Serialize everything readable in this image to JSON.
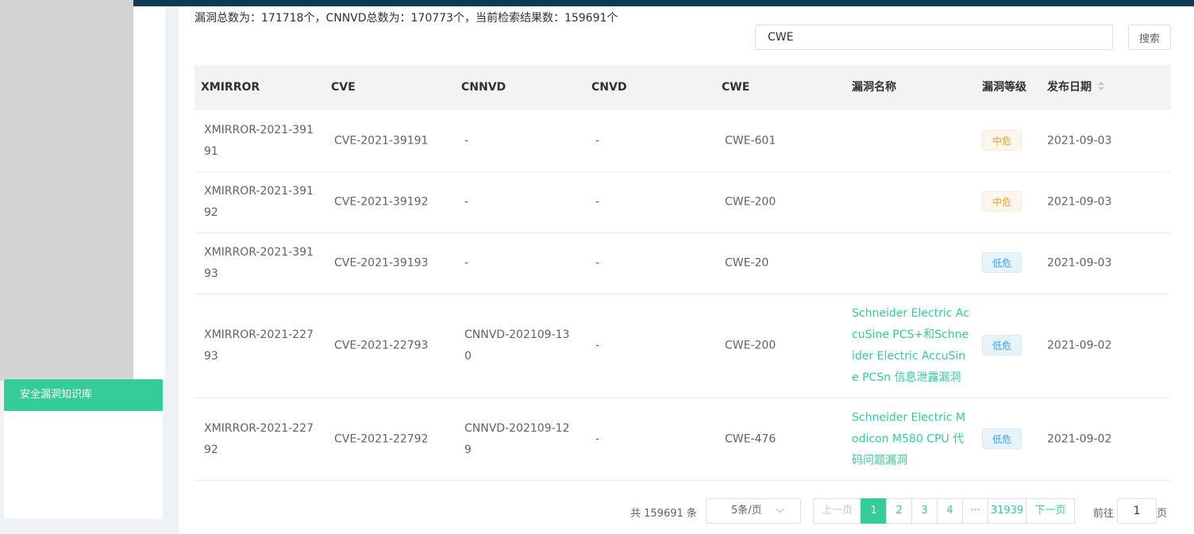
{
  "sidebar": {
    "active_item": "安全漏洞知识库"
  },
  "summary": "漏洞总数为：171718个，CNNVD总数为：170773个，当前检索结果数：159691个",
  "search": {
    "value": "CWE",
    "button": "搜索"
  },
  "table": {
    "headers": [
      "XMIRROR",
      "CVE",
      "CNNVD",
      "CNVD",
      "CWE",
      "漏洞名称",
      "漏洞等级",
      "发布日期"
    ],
    "rows": [
      {
        "xmirror": "XMIRROR-2021-39191",
        "cve": "CVE-2021-39191",
        "cnnvd": "-",
        "cnvd": "-",
        "cwe": "CWE-601",
        "name": "",
        "level": "中危",
        "date": "2021-09-03"
      },
      {
        "xmirror": "XMIRROR-2021-39192",
        "cve": "CVE-2021-39192",
        "cnnvd": "-",
        "cnvd": "-",
        "cwe": "CWE-200",
        "name": "",
        "level": "中危",
        "date": "2021-09-03"
      },
      {
        "xmirror": "XMIRROR-2021-39193",
        "cve": "CVE-2021-39193",
        "cnnvd": "-",
        "cnvd": "-",
        "cwe": "CWE-20",
        "name": "",
        "level": "低危",
        "date": "2021-09-03"
      },
      {
        "xmirror": "XMIRROR-2021-22793",
        "cve": "CVE-2021-22793",
        "cnnvd": "CNNVD-202109-130",
        "cnvd": "-",
        "cwe": "CWE-200",
        "name": "Schneider Electric AccuSine PCS+和Schneider Electric AccuSine PCSn 信息泄露漏洞",
        "level": "低危",
        "date": "2021-09-02"
      },
      {
        "xmirror": "XMIRROR-2021-22792",
        "cve": "CVE-2021-22792",
        "cnnvd": "CNNVD-202109-129",
        "cnvd": "-",
        "cwe": "CWE-476",
        "name": "Schneider Electric Modicon M580 CPU 代码问题漏洞",
        "level": "低危",
        "date": "2021-09-02"
      }
    ]
  },
  "pagination": {
    "total_text": "共 159691 条",
    "page_size": "5条/页",
    "prev": "上一页",
    "pages": [
      "1",
      "2",
      "3",
      "4"
    ],
    "ellipsis": "···",
    "last_page": "31939",
    "next": "下一页",
    "goto_label": "前往",
    "goto_value": "1",
    "goto_suffix": "页"
  },
  "colors": {
    "accent": "#34cc98",
    "topbar": "#0e3a52",
    "medium_badge": "#e6a23c",
    "low_badge": "#409eff"
  }
}
